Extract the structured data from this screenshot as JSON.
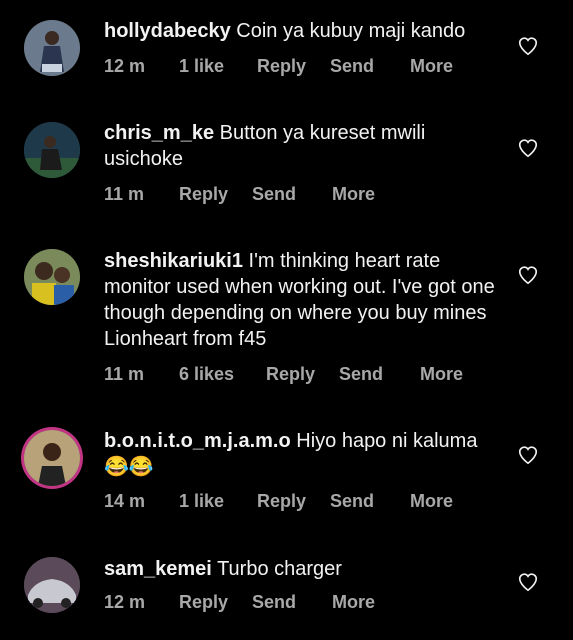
{
  "comments": [
    {
      "username": "hollydabecky",
      "text": "Coin ya kubuy maji kando",
      "time": "12 m",
      "likes": "1 like",
      "reply": "Reply",
      "send": "Send",
      "more": "More"
    },
    {
      "username": "chris_m_ke",
      "text": "Button ya kureset mwili usichoke",
      "time": "11 m",
      "likes": "",
      "reply": "Reply",
      "send": "Send",
      "more": "More"
    },
    {
      "username": "sheshikariuki1",
      "text": "I'm thinking heart rate monitor used when working out. I've got one though depending on where you buy mines Lionheart from f45",
      "time": "11 m",
      "likes": "6 likes",
      "reply": "Reply",
      "send": "Send",
      "more": "More"
    },
    {
      "username": "b.o.n.i.t.o_m.j.a.m.o",
      "text": "Hiyo hapo ni kaluma😂😂",
      "time": "14 m",
      "likes": "1 like",
      "reply": "Reply",
      "send": "Send",
      "more": "More"
    },
    {
      "username": "sam_kemei",
      "text": "Turbo charger",
      "time": "12 m",
      "likes": "",
      "reply": "Reply",
      "send": "Send",
      "more": "More"
    }
  ],
  "icons": {
    "like": "heart-outline-icon"
  },
  "colors": {
    "background": "#000000",
    "text": "#f2f2f2",
    "meta": "#a8a8a8",
    "story_ring": "#c13584"
  }
}
